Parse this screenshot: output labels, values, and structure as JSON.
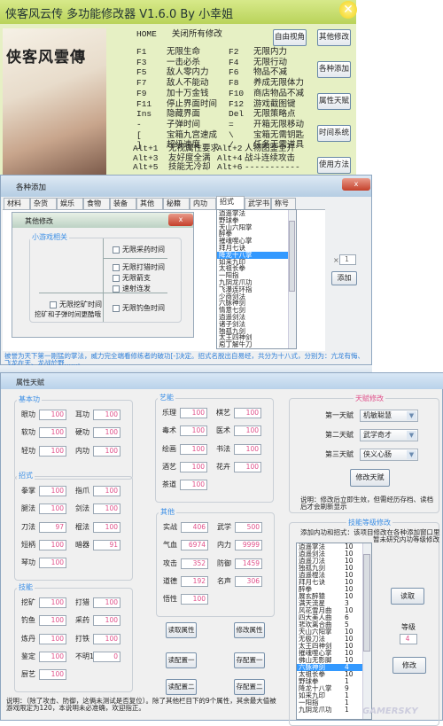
{
  "main": {
    "title": "侠客风云传 多功能修改器 V1.6.0 By 小幸姐",
    "poster_logo": "侠客风雲傳",
    "home_key": "HOME",
    "home_desc": "关闭所有修改",
    "hotkeys": [
      [
        "F1",
        "无限生命",
        "F2",
        "无限内力"
      ],
      [
        "F3",
        "一击必杀",
        "F4",
        "无限行动"
      ],
      [
        "F5",
        "敌人零内力",
        "F6",
        "物品不减"
      ],
      [
        "F7",
        "敌人不能动",
        "F8",
        "养成无限体力"
      ],
      [
        "F9",
        "加十万金钱",
        "F10",
        "商店物品不减"
      ],
      [
        "F11",
        "停止界面时间",
        "F12",
        "游戏截图键"
      ],
      [
        "Ins",
        "隐藏界面",
        "Del",
        "无限策略点"
      ],
      [
        "-",
        "子弹时间",
        "=",
        "开箱无限移动"
      ],
      [
        "[",
        "宝箱九宫速成",
        "\\",
        "宝箱无需钥匙"
      ],
      [
        "]",
        "超级速度",
        "/",
        "任务无需道具"
      ]
    ],
    "alt_keys": [
      [
        "Alt+1",
        "无视属性要求",
        "Alt+2",
        "人物图鉴全开"
      ],
      [
        "Alt+3",
        "友好度全满",
        "Alt+4",
        "战斗连续攻击"
      ],
      [
        "Alt+5",
        "技能无冷却",
        "Alt+6",
        "-----------"
      ]
    ],
    "free_view": "自由视角",
    "side_buttons": [
      "其他修改",
      "各种添加",
      "属性天赋",
      "时间系统",
      "使用方法"
    ],
    "close_icon": "close-icon"
  },
  "add": {
    "title": "各种添加",
    "close": "x",
    "tabs": [
      "材料",
      "杂货",
      "娱乐",
      "食物",
      "装备",
      "其他",
      "秘籍",
      "内功",
      "招式",
      "武学书",
      "称号"
    ],
    "active_tab": 8,
    "items": [
      "逍遥掌法",
      "野球拳",
      "天山六阳掌",
      "醉拳",
      "摧魂噬心掌",
      "拜月七诀",
      "降龙十八掌",
      "如来九印",
      "太祖长拳",
      "一阳指",
      "九阴龙爪功",
      "飞瀑连环指",
      "少商剑法",
      "六脉神剑",
      "情意七剑",
      "逍遥剑法",
      "诸子剑法",
      "独孤九剑",
      "太王四神剑",
      "庖丁解牛刀"
    ],
    "selected_item": 6,
    "qty_prefix": "×",
    "qty": "1",
    "add_label": "添加",
    "desc": "被誉为天下第一刚猛的掌法，威力完全端看修练者的破功[-]决定。招式名脱出自易经，共分为十八式，分别为：亢龙有悔、飞龙在天、龙战於野……。",
    "other": {
      "title": "其他修改",
      "close": "x",
      "group": "小游戏相关",
      "checks": [
        "无限采药时间",
        "无限打猎时间",
        "无限箭支",
        "速射连发",
        "无限挖矿时间",
        "无限钓鱼时间"
      ],
      "mine_note": "挖矿和子弹时间更酷哦"
    }
  },
  "attr": {
    "title": "属性天赋",
    "groups": [
      {
        "label": "基本功",
        "fields": [
          [
            "眼功",
            "100"
          ],
          [
            "耳功",
            "100"
          ],
          [
            "软功",
            "100"
          ],
          [
            "硬功",
            "100"
          ],
          [
            "轻功",
            "100"
          ],
          [
            "内功",
            "100"
          ]
        ]
      },
      {
        "label": "招式",
        "fields": [
          [
            "拳掌",
            "100"
          ],
          [
            "指爪",
            "100"
          ],
          [
            "腿法",
            "100"
          ],
          [
            "剑法",
            "100"
          ],
          [
            "刀法",
            "97"
          ],
          [
            "棍法",
            "100"
          ],
          [
            "短柄",
            "100"
          ],
          [
            "暗器",
            "91"
          ],
          [
            "琴功",
            "100"
          ]
        ]
      },
      {
        "label": "技能",
        "fields": [
          [
            "挖矿",
            "100"
          ],
          [
            "打猎",
            "100"
          ],
          [
            "钓鱼",
            "100"
          ],
          [
            "采药",
            "100"
          ],
          [
            "炼丹",
            "100"
          ],
          [
            "打铁",
            "100"
          ],
          [
            "鉴定",
            "100"
          ],
          [
            "不明1",
            "0"
          ],
          [
            "厨艺",
            "100"
          ]
        ]
      },
      {
        "label": "艺能",
        "fields": [
          [
            "乐理",
            "100"
          ],
          [
            "棋艺",
            "100"
          ],
          [
            "毒术",
            "100"
          ],
          [
            "医术",
            "100"
          ],
          [
            "绘画",
            "100"
          ],
          [
            "书法",
            "100"
          ],
          [
            "酒艺",
            "100"
          ],
          [
            "花卉",
            "100"
          ],
          [
            "茶道",
            "100"
          ]
        ]
      },
      {
        "label": "其他",
        "fields": [
          [
            "实战",
            "406"
          ],
          [
            "武学",
            "500"
          ],
          [
            "气血",
            "6974"
          ],
          [
            "内力",
            "9999"
          ],
          [
            "攻击",
            "352"
          ],
          [
            "防御",
            "1459"
          ],
          [
            "道德",
            "192"
          ],
          [
            "名声",
            "306"
          ],
          [
            "悟性",
            "100"
          ]
        ]
      }
    ],
    "buttons": [
      "读取属性",
      "修改属性",
      "读配置一",
      "存配置一",
      "读配置二",
      "存配置二"
    ],
    "note": "说明：（除了攻击、防御，这俩未测试是否复位）。除了其他栏目下的9个属性，其余最大值被游戏限定为120，本说明未必准确，欢迎指正。",
    "talent": {
      "label": "天赋修改",
      "rows": [
        [
          "第一天赋",
          "机敏聪慧"
        ],
        [
          "第二天赋",
          "武学奇才"
        ],
        [
          "第三天赋",
          "侠义心肠"
        ]
      ],
      "button": "修改天赋",
      "note": "说明：修改后立即生效，但需经历存档、读档后才会刷新显示"
    },
    "skill": {
      "label": "技能等级修改",
      "note1": "添加内功和招式：该项目修改在各种添加窗口里",
      "note2": "暂未研究内功等级修改",
      "list": [
        [
          "逍遥掌法",
          "10"
        ],
        [
          "逍遥剑法",
          "10"
        ],
        [
          "逍遥刀法",
          "10"
        ],
        [
          "独孤九剑",
          "10"
        ],
        [
          "逍遥棍法",
          "10"
        ],
        [
          "拜月七诀",
          "10"
        ],
        [
          "醉拳",
          "10"
        ],
        [
          "展玄醉猿",
          "10"
        ],
        [
          "满天流星",
          "3"
        ],
        [
          "风花雪月曲",
          "10"
        ],
        [
          "四大美人曲",
          "6"
        ],
        [
          "悲欢离合曲",
          "5"
        ],
        [
          "天山六阳掌",
          "10"
        ],
        [
          "无极刀法",
          "10"
        ],
        [
          "太王四神剑",
          "10"
        ],
        [
          "摧魂噬心掌",
          "10"
        ],
        [
          "佛山无影脚",
          "10"
        ],
        [
          "六脉神剑",
          "4"
        ],
        [
          "太祖长拳",
          "10"
        ],
        [
          "野球拳",
          "1"
        ],
        [
          "降龙十八掌",
          "9"
        ],
        [
          "如来九印",
          "1"
        ],
        [
          "一阳指",
          "1"
        ],
        [
          "九阴龙爪功",
          "1"
        ]
      ],
      "selected": 17,
      "read": "读取",
      "level_label": "等级",
      "level": "4",
      "modify": "修改"
    },
    "watermark": "GAMERSKY"
  }
}
